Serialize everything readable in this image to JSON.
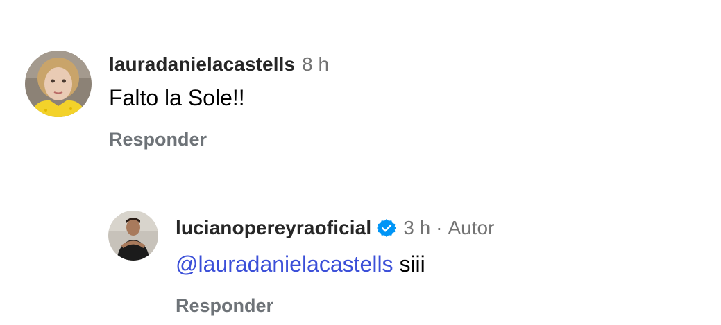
{
  "comment": {
    "username": "lauradanielacastells",
    "time": "8 h",
    "text": "Falto la Sole!!",
    "reply_label": "Responder"
  },
  "reply": {
    "username": "lucianopereyraoficial",
    "verified": true,
    "time": "3 h",
    "separator": "·",
    "role": "Autor",
    "mention": "@lauradanielacastells",
    "text": "siii",
    "reply_label": "Responder"
  },
  "colors": {
    "username": "#262626",
    "meta": "#737373",
    "mention": "#3b4fd8",
    "reply_button": "#6e7378",
    "verified_badge": "#0095f6"
  }
}
